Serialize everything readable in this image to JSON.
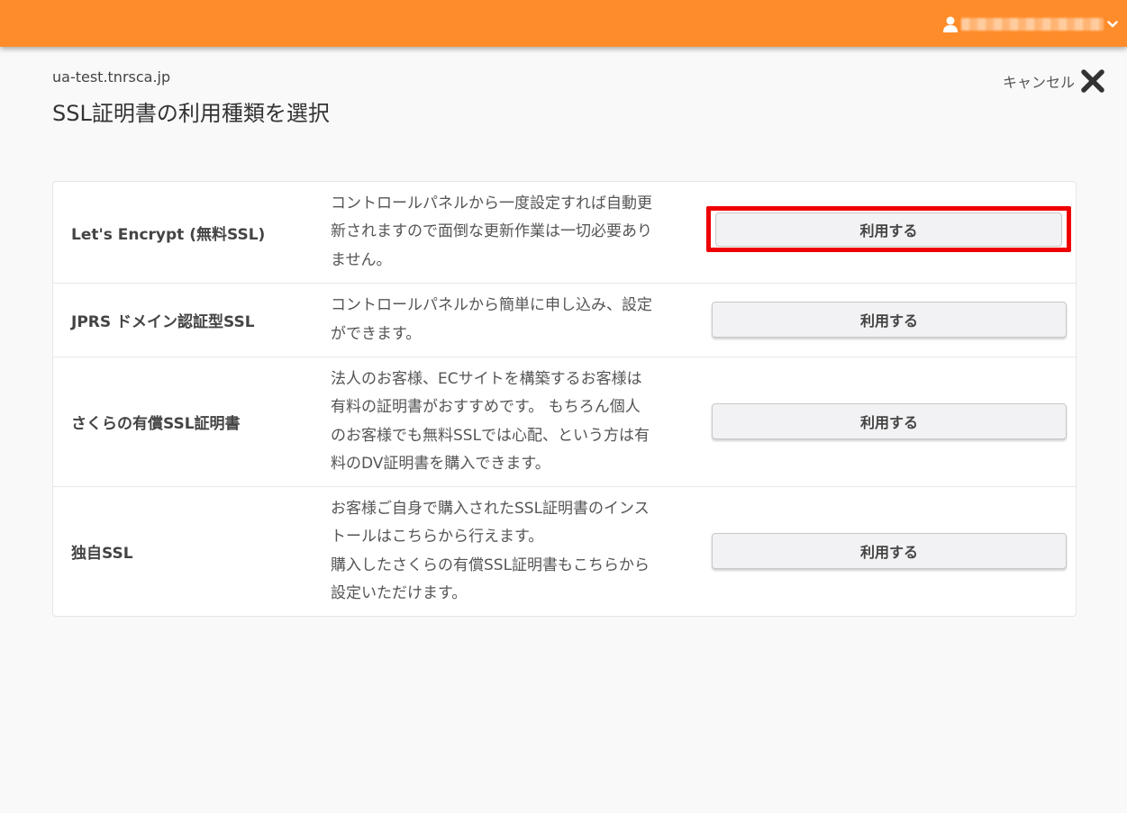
{
  "header": {
    "user_name": "████████████████",
    "user_icon": "user-icon",
    "menu_icon": "chevron-down-icon",
    "brand_color": "#ff8c2a"
  },
  "page": {
    "domain": "ua-test.tnrsca.jp",
    "title": "SSL証明書の利用種類を選択",
    "cancel_label": "キャンセル",
    "cancel_icon": "close-icon"
  },
  "options": [
    {
      "name": "Let's Encrypt (無料SSL)",
      "description": "コントロールパネルから一度設定すれば自動更\n新されますので面倒な更新作業は一切必要あり\nません。",
      "button_label": "利用する",
      "highlighted": true,
      "highlight_color": "#ee0000"
    },
    {
      "name": "JPRS ドメイン認証型SSL",
      "description": "コントロールパネルから簡単に申し込み、設定\nができます。",
      "button_label": "利用する"
    },
    {
      "name": "さくらの有償SSL証明書",
      "description": "法人のお客様、ECサイトを構築するお客様は\n有料の証明書がおすすめです。 もちろん個人\nのお客様でも無料SSLでは心配、という方は有\n料のDV証明書を購入できます。",
      "button_label": "利用する"
    },
    {
      "name": "独自SSL",
      "description": "お客様ご自身で購入されたSSL証明書のインス\nトールはこちらから行えます。\n購入したさくらの有償SSL証明書もこちらから\n設定いただけます。",
      "button_label": "利用する"
    }
  ]
}
